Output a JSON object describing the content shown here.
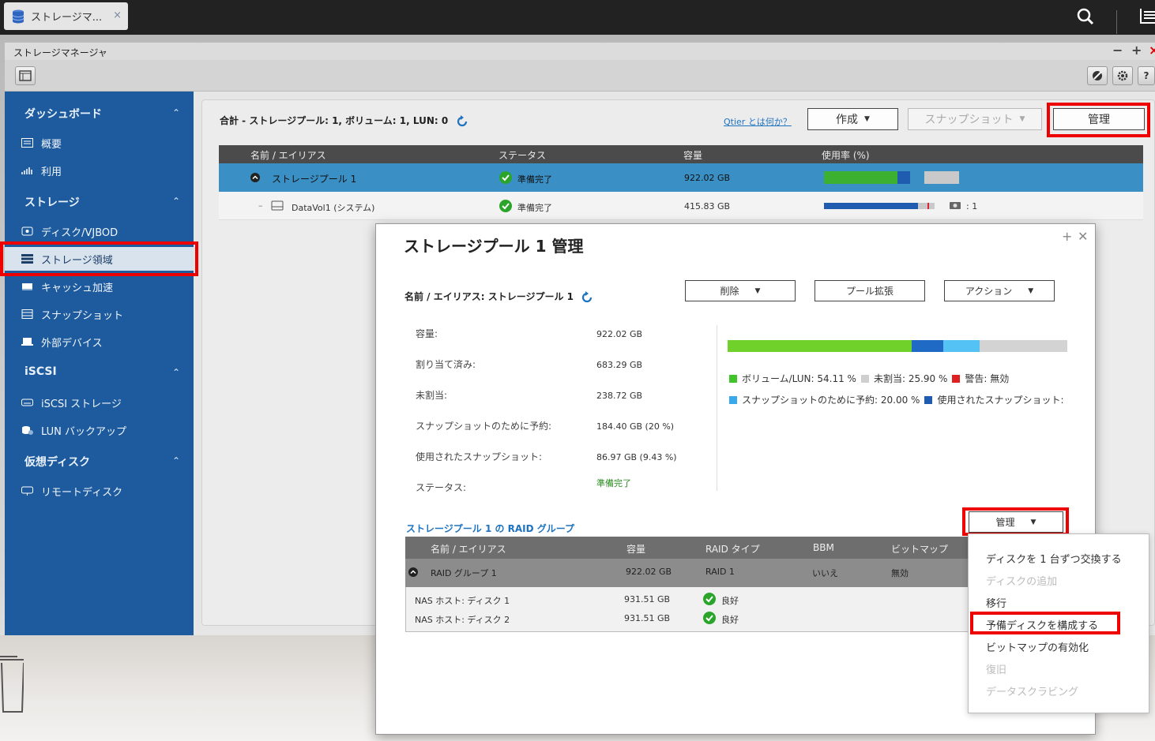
{
  "topbar": {
    "tab_label": "ストレージマ...",
    "tab_close": "×"
  },
  "window": {
    "title": "ストレージマネージャ",
    "minimize": "−",
    "maximize": "+",
    "close": "×"
  },
  "sidebar": {
    "sections": [
      {
        "label": "ダッシュボード",
        "caret": "^"
      },
      {
        "label": "ストレージ",
        "caret": "^"
      },
      {
        "label": "iSCSI",
        "caret": "^"
      },
      {
        "label": "仮想ディスク",
        "caret": "^"
      }
    ],
    "items": [
      {
        "label": "概要",
        "icon": "overview-icon"
      },
      {
        "label": "利用",
        "icon": "usage-icon"
      },
      {
        "label": "ディスク/VJBOD",
        "icon": "disk-icon"
      },
      {
        "label": "ストレージ領域",
        "icon": "storage-space-icon"
      },
      {
        "label": "キャッシュ加速",
        "icon": "cache-icon"
      },
      {
        "label": "スナップショット",
        "icon": "snapshot-icon"
      },
      {
        "label": "外部デバイス",
        "icon": "external-device-icon"
      },
      {
        "label": "iSCSI ストレージ",
        "icon": "iscsi-storage-icon"
      },
      {
        "label": "LUN バックアップ",
        "icon": "lun-backup-icon"
      },
      {
        "label": "リモートディスク",
        "icon": "remote-disk-icon"
      }
    ],
    "active_index": 3
  },
  "main": {
    "summary": "合計 - ストレージプール: 1, ボリューム: 1, LUN: 0",
    "qtier_link": "Qtier とは何か？",
    "create_button": "作成",
    "snapshot_button": "スナップショット",
    "manage_button": "管理",
    "table": {
      "headers": [
        "名前 / エイリアス",
        "ステータス",
        "容量",
        "使用率 (%)"
      ],
      "rows": [
        {
          "name": "ストレージプール 1",
          "status": "準備完了",
          "capacity": "922.02 GB",
          "usage": {
            "used": 0.54,
            "snap": 0.094,
            "reserved": 0.2
          }
        },
        {
          "name": "DataVol1 (システム)",
          "status": "準備完了",
          "capacity": "415.83 GB",
          "usage": {
            "used": 0.85
          },
          "snapshots": ": 1"
        }
      ]
    }
  },
  "modal": {
    "title": "ストレージプール 1 管理",
    "name_label": "名前 / エイリアス: ストレージプール 1",
    "delete_button": "削除",
    "expand_button": "プール拡張",
    "action_button": "アクション",
    "fields": [
      {
        "label": "容量:",
        "value": "922.02 GB"
      },
      {
        "label": "割り当て済み:",
        "value": "683.29 GB"
      },
      {
        "label": "未割当:",
        "value": "238.72 GB"
      },
      {
        "label": "スナップショットのために予約:",
        "value": "184.40 GB (20 %)"
      },
      {
        "label": "使用されたスナップショット:",
        "value": "86.97 GB (9.43 %)"
      },
      {
        "label": "ステータス:",
        "value": "準備完了"
      }
    ],
    "bar": {
      "volume": 54.11,
      "used_snapshot": 9.43,
      "reserved_free": 10.57,
      "unallocated": 25.9
    },
    "legend_line1": "ボリューム/LUN:  54.11 %",
    "legend_unalloc": "未割当:  25.90 %",
    "legend_warning": "警告:  無効",
    "legend_reserve": "スナップショットのために予約:  20.00 %",
    "legend_used_snap": "使用されたスナップショット:",
    "raid_title": "ストレージプール 1 の RAID グループ",
    "manage_button": "管理",
    "raid_table": {
      "headers": [
        "名前 / エイリアス",
        "容量",
        "RAID タイプ",
        "BBM",
        "ビットマップ"
      ],
      "group": {
        "name": "RAID グループ 1",
        "capacity": "922.02 GB",
        "type": "RAID 1",
        "bbm": "いいえ",
        "bitmap": "無効"
      },
      "disks": [
        {
          "name": "NAS ホスト: ディスク 1",
          "capacity": "931.51 GB",
          "status": "良好"
        },
        {
          "name": "NAS ホスト: ディスク 2",
          "capacity": "931.51 GB",
          "status": "良好"
        }
      ]
    },
    "dropdown": [
      {
        "label": "ディスクを 1 台ずつ交換する",
        "enabled": true
      },
      {
        "label": "ディスクの追加",
        "enabled": false
      },
      {
        "label": "移行",
        "enabled": true
      },
      {
        "label": "予備ディスクを構成する",
        "enabled": true
      },
      {
        "label": "ビットマップの有効化",
        "enabled": true
      },
      {
        "label": "復旧",
        "enabled": false
      },
      {
        "label": "データスクラビング",
        "enabled": false
      }
    ]
  },
  "colors": {
    "sidebar": "#1d5b9e",
    "selected_row": "#3a8fc4",
    "green_bar": "#6fd12a",
    "blue_bar": "#1f6ac4",
    "light_blue_bar": "#54c2f4",
    "gray_bar": "#d3d3d3",
    "highlight": "#e00000"
  }
}
